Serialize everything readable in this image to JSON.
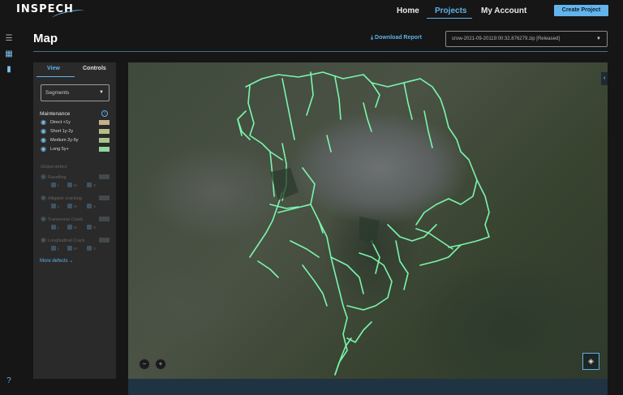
{
  "app": {
    "logo": "INSPECH"
  },
  "nav": {
    "home": "Home",
    "projects": "Projects",
    "account": "My Account",
    "create_project": "Create Project"
  },
  "sidebar": {
    "icons": [
      "menu-icon",
      "grid-icon",
      "chart-icon",
      "map-icon"
    ],
    "help_icon": "help-icon"
  },
  "page": {
    "title": "Map",
    "download_report": "Download Report",
    "file_select": "crow-2021-09-20119:00:32.876279.zip [Released]"
  },
  "panel": {
    "tabs": {
      "view": "View",
      "controls": "Controls"
    },
    "segments_select": "Segments",
    "maintenance": {
      "title": "Maintenance",
      "items": [
        {
          "label": "Direct <1y",
          "color": "#c9b08a"
        },
        {
          "label": "Short 1y-2y",
          "color": "#b7bd86"
        },
        {
          "label": "Medium 2y-5y",
          "color": "#a8c48b"
        },
        {
          "label": "Long 5y+",
          "color": "#8fd79a"
        }
      ]
    },
    "global_defect": {
      "title": "Global defect",
      "items": [
        {
          "label": "Ravelling",
          "levels": [
            "L",
            "M",
            "S"
          ]
        },
        {
          "label": "Alligator cracking",
          "levels": [
            "L",
            "M",
            "S"
          ]
        },
        {
          "label": "Transverse Crack",
          "levels": [
            "L",
            "M",
            "S"
          ]
        },
        {
          "label": "Longitudinal Crack",
          "levels": [
            "L",
            "M",
            "S"
          ]
        }
      ]
    },
    "more_defects": "More defects"
  },
  "map": {
    "road_color": "#7dffb2",
    "zoom_out": "−",
    "zoom_in": "+"
  }
}
